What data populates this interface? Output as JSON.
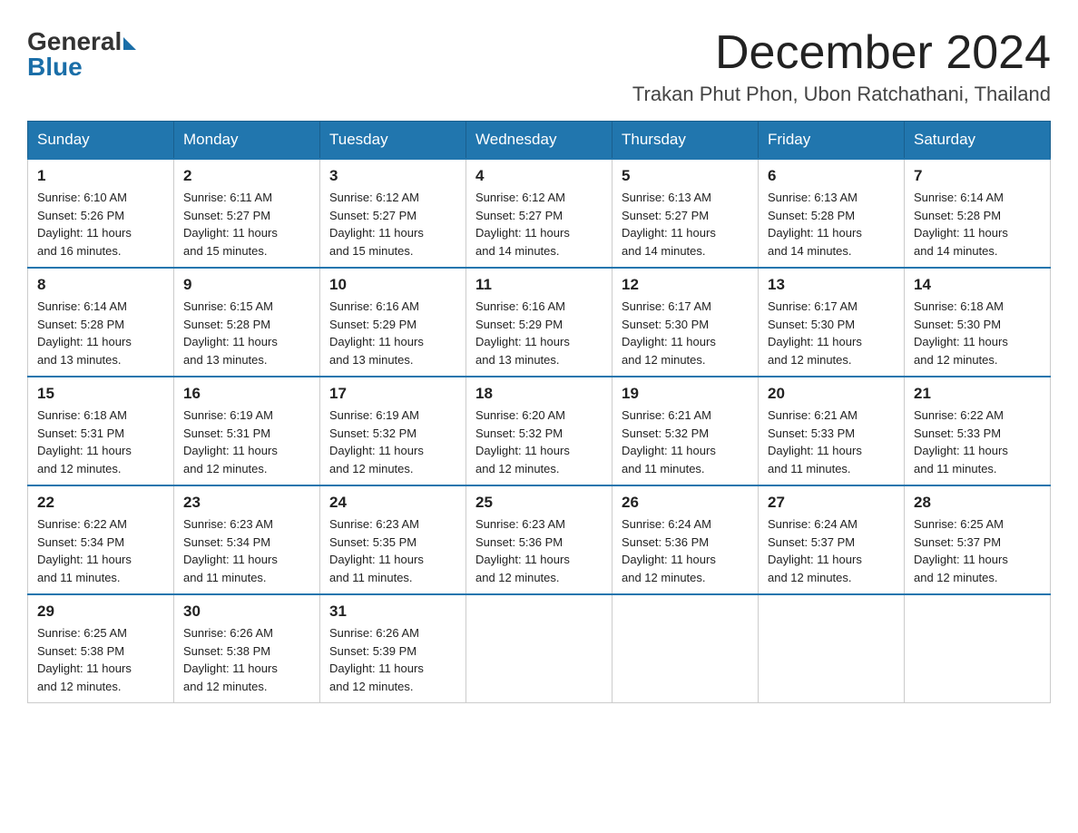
{
  "header": {
    "logo_general": "General",
    "logo_blue": "Blue",
    "month_title": "December 2024",
    "location": "Trakan Phut Phon, Ubon Ratchathani, Thailand"
  },
  "days_of_week": [
    "Sunday",
    "Monday",
    "Tuesday",
    "Wednesday",
    "Thursday",
    "Friday",
    "Saturday"
  ],
  "weeks": [
    [
      {
        "day": "1",
        "info": "Sunrise: 6:10 AM\nSunset: 5:26 PM\nDaylight: 11 hours\nand 16 minutes."
      },
      {
        "day": "2",
        "info": "Sunrise: 6:11 AM\nSunset: 5:27 PM\nDaylight: 11 hours\nand 15 minutes."
      },
      {
        "day": "3",
        "info": "Sunrise: 6:12 AM\nSunset: 5:27 PM\nDaylight: 11 hours\nand 15 minutes."
      },
      {
        "day": "4",
        "info": "Sunrise: 6:12 AM\nSunset: 5:27 PM\nDaylight: 11 hours\nand 14 minutes."
      },
      {
        "day": "5",
        "info": "Sunrise: 6:13 AM\nSunset: 5:27 PM\nDaylight: 11 hours\nand 14 minutes."
      },
      {
        "day": "6",
        "info": "Sunrise: 6:13 AM\nSunset: 5:28 PM\nDaylight: 11 hours\nand 14 minutes."
      },
      {
        "day": "7",
        "info": "Sunrise: 6:14 AM\nSunset: 5:28 PM\nDaylight: 11 hours\nand 14 minutes."
      }
    ],
    [
      {
        "day": "8",
        "info": "Sunrise: 6:14 AM\nSunset: 5:28 PM\nDaylight: 11 hours\nand 13 minutes."
      },
      {
        "day": "9",
        "info": "Sunrise: 6:15 AM\nSunset: 5:28 PM\nDaylight: 11 hours\nand 13 minutes."
      },
      {
        "day": "10",
        "info": "Sunrise: 6:16 AM\nSunset: 5:29 PM\nDaylight: 11 hours\nand 13 minutes."
      },
      {
        "day": "11",
        "info": "Sunrise: 6:16 AM\nSunset: 5:29 PM\nDaylight: 11 hours\nand 13 minutes."
      },
      {
        "day": "12",
        "info": "Sunrise: 6:17 AM\nSunset: 5:30 PM\nDaylight: 11 hours\nand 12 minutes."
      },
      {
        "day": "13",
        "info": "Sunrise: 6:17 AM\nSunset: 5:30 PM\nDaylight: 11 hours\nand 12 minutes."
      },
      {
        "day": "14",
        "info": "Sunrise: 6:18 AM\nSunset: 5:30 PM\nDaylight: 11 hours\nand 12 minutes."
      }
    ],
    [
      {
        "day": "15",
        "info": "Sunrise: 6:18 AM\nSunset: 5:31 PM\nDaylight: 11 hours\nand 12 minutes."
      },
      {
        "day": "16",
        "info": "Sunrise: 6:19 AM\nSunset: 5:31 PM\nDaylight: 11 hours\nand 12 minutes."
      },
      {
        "day": "17",
        "info": "Sunrise: 6:19 AM\nSunset: 5:32 PM\nDaylight: 11 hours\nand 12 minutes."
      },
      {
        "day": "18",
        "info": "Sunrise: 6:20 AM\nSunset: 5:32 PM\nDaylight: 11 hours\nand 12 minutes."
      },
      {
        "day": "19",
        "info": "Sunrise: 6:21 AM\nSunset: 5:32 PM\nDaylight: 11 hours\nand 11 minutes."
      },
      {
        "day": "20",
        "info": "Sunrise: 6:21 AM\nSunset: 5:33 PM\nDaylight: 11 hours\nand 11 minutes."
      },
      {
        "day": "21",
        "info": "Sunrise: 6:22 AM\nSunset: 5:33 PM\nDaylight: 11 hours\nand 11 minutes."
      }
    ],
    [
      {
        "day": "22",
        "info": "Sunrise: 6:22 AM\nSunset: 5:34 PM\nDaylight: 11 hours\nand 11 minutes."
      },
      {
        "day": "23",
        "info": "Sunrise: 6:23 AM\nSunset: 5:34 PM\nDaylight: 11 hours\nand 11 minutes."
      },
      {
        "day": "24",
        "info": "Sunrise: 6:23 AM\nSunset: 5:35 PM\nDaylight: 11 hours\nand 11 minutes."
      },
      {
        "day": "25",
        "info": "Sunrise: 6:23 AM\nSunset: 5:36 PM\nDaylight: 11 hours\nand 12 minutes."
      },
      {
        "day": "26",
        "info": "Sunrise: 6:24 AM\nSunset: 5:36 PM\nDaylight: 11 hours\nand 12 minutes."
      },
      {
        "day": "27",
        "info": "Sunrise: 6:24 AM\nSunset: 5:37 PM\nDaylight: 11 hours\nand 12 minutes."
      },
      {
        "day": "28",
        "info": "Sunrise: 6:25 AM\nSunset: 5:37 PM\nDaylight: 11 hours\nand 12 minutes."
      }
    ],
    [
      {
        "day": "29",
        "info": "Sunrise: 6:25 AM\nSunset: 5:38 PM\nDaylight: 11 hours\nand 12 minutes."
      },
      {
        "day": "30",
        "info": "Sunrise: 6:26 AM\nSunset: 5:38 PM\nDaylight: 11 hours\nand 12 minutes."
      },
      {
        "day": "31",
        "info": "Sunrise: 6:26 AM\nSunset: 5:39 PM\nDaylight: 11 hours\nand 12 minutes."
      },
      {
        "day": "",
        "info": ""
      },
      {
        "day": "",
        "info": ""
      },
      {
        "day": "",
        "info": ""
      },
      {
        "day": "",
        "info": ""
      }
    ]
  ]
}
